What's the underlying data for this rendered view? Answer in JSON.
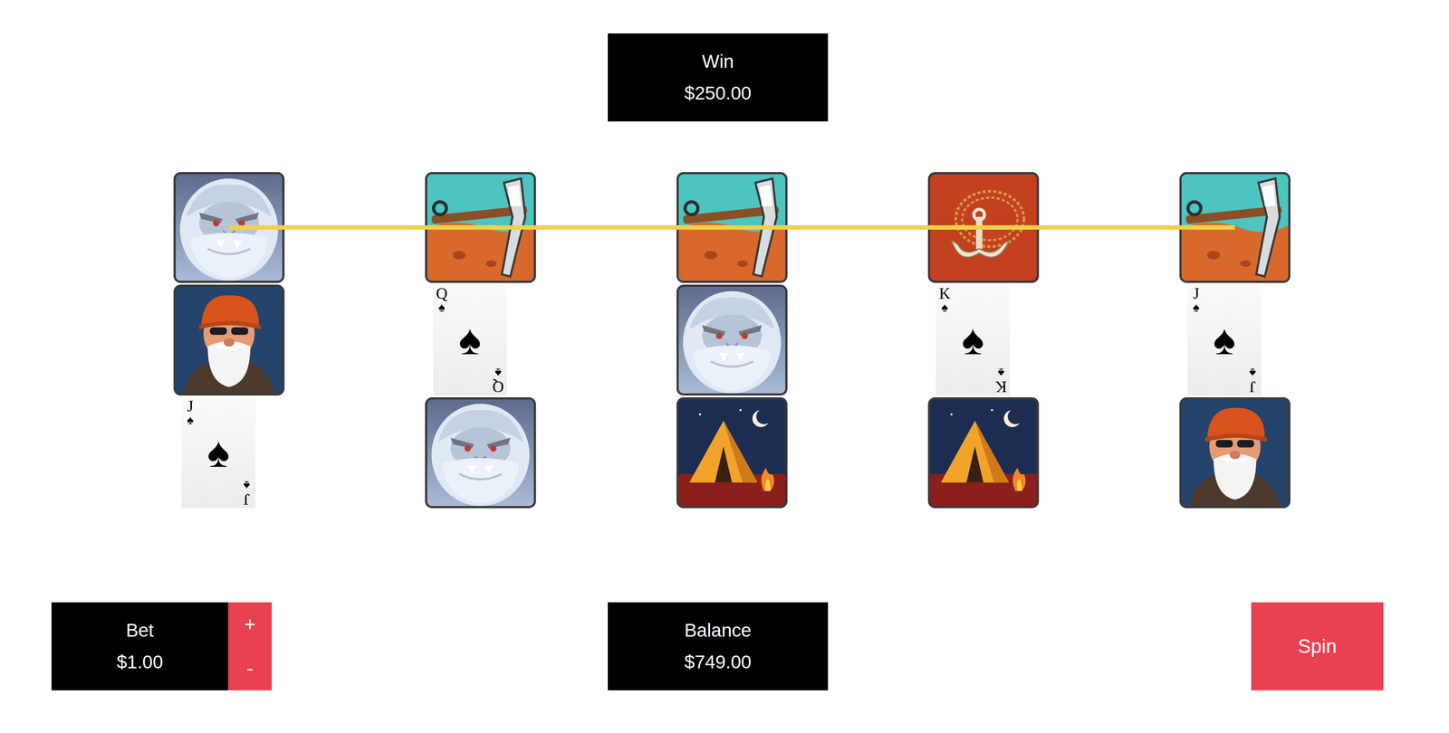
{
  "win": {
    "label": "Win",
    "value": "$250.00"
  },
  "reels": [
    {
      "symbols": [
        {
          "kind": "yeti"
        },
        {
          "kind": "miner"
        },
        {
          "kind": "card",
          "rank": "J",
          "suit": "♠"
        }
      ]
    },
    {
      "symbols": [
        {
          "kind": "pickaxe"
        },
        {
          "kind": "card",
          "rank": "Q",
          "suit": "♠"
        },
        {
          "kind": "yeti"
        }
      ]
    },
    {
      "symbols": [
        {
          "kind": "pickaxe"
        },
        {
          "kind": "yeti"
        },
        {
          "kind": "tent"
        }
      ]
    },
    {
      "symbols": [
        {
          "kind": "hook"
        },
        {
          "kind": "card",
          "rank": "K",
          "suit": "♠"
        },
        {
          "kind": "tent"
        }
      ]
    },
    {
      "symbols": [
        {
          "kind": "pickaxe"
        },
        {
          "kind": "card",
          "rank": "J",
          "suit": "♠"
        },
        {
          "kind": "miner"
        }
      ]
    }
  ],
  "paylines": [
    {
      "rows": [
        0,
        0,
        0,
        0,
        0
      ]
    }
  ],
  "bet": {
    "label": "Bet",
    "value": "$1.00",
    "increase": "+",
    "decrease": "-"
  },
  "balance": {
    "label": "Balance",
    "value": "$749.00"
  },
  "spin": {
    "label": "Spin"
  }
}
